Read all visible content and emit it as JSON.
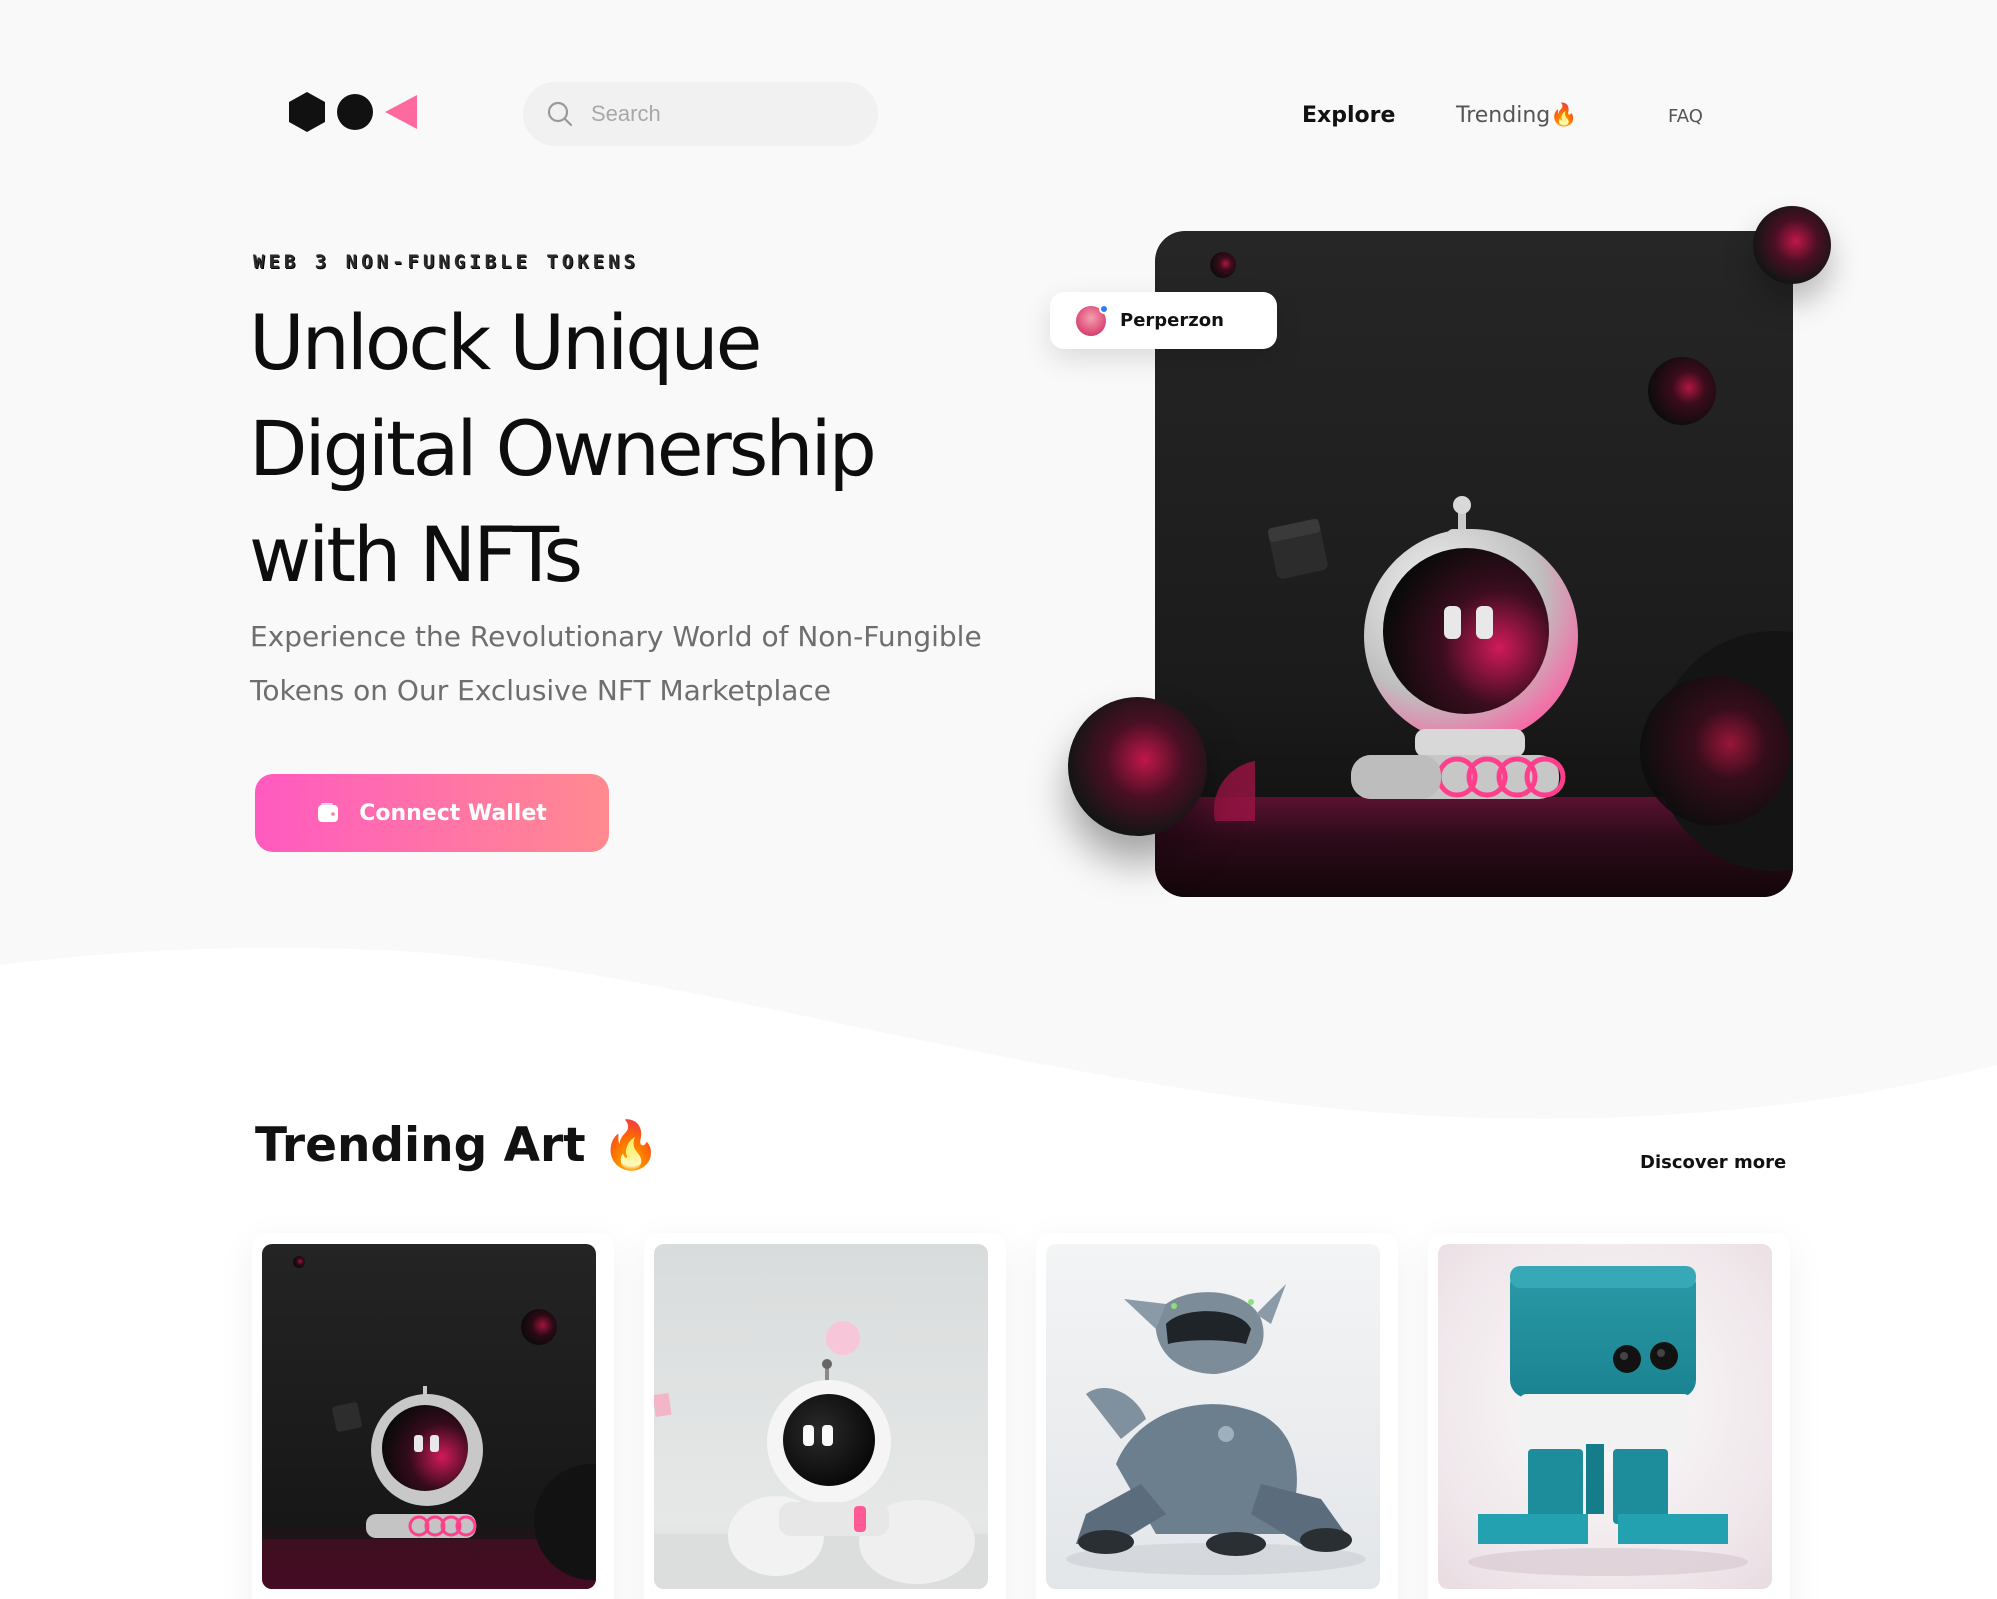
{
  "header": {
    "logo_alt": "brand logo",
    "search_placeholder": "Search",
    "nav": {
      "explore": "Explore",
      "trending": "Trending🔥",
      "faq": "FAQ"
    }
  },
  "hero": {
    "eyebrow": "WEB 3 NON-FUNGIBLE TOKENS",
    "title_lines": [
      "Unlock Unique",
      "Digital Ownership",
      "with NFTs"
    ],
    "subtitle_lines": [
      "Experience the Revolutionary World of Non-Fungible",
      "Tokens on Our Exclusive NFT Marketplace"
    ],
    "cta_label": "Connect Wallet",
    "creator": {
      "name": "Perperzon",
      "verified": true
    }
  },
  "trending": {
    "title": "Trending Art",
    "title_icon": "🔥",
    "discover_label": "Discover more",
    "cards": [
      {
        "image": "dark-rover-robot-art"
      },
      {
        "image": "light-rover-robot-art"
      },
      {
        "image": "robot-dog-art"
      },
      {
        "image": "teal-cube-robot-art"
      }
    ]
  },
  "colors": {
    "accent_start": "#ff5ac0",
    "accent_end": "#ff8a90",
    "page_bg": "#f9f9f9",
    "text_primary": "#0d0d0d",
    "text_secondary": "#6e6e6e"
  }
}
